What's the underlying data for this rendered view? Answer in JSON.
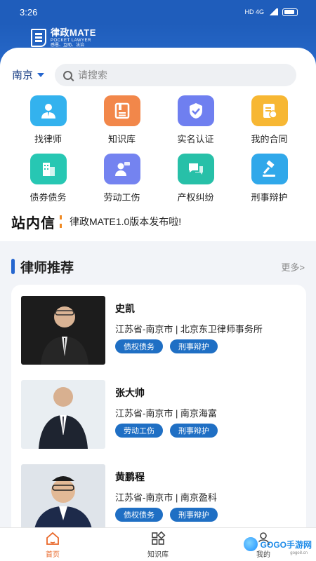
{
  "status": {
    "time": "3:26",
    "icons_right": "HD 4G"
  },
  "app": {
    "name": "律政MATE",
    "tagline": "POCKET LAWYER",
    "slogan": "感恩、互助、法治"
  },
  "search": {
    "city": "南京",
    "placeholder": "请搜索"
  },
  "features": [
    {
      "label": "找律师",
      "color": "#33b2ee",
      "icon": "lawyer-icon"
    },
    {
      "label": "知识库",
      "color": "#f2874a",
      "icon": "book-icon"
    },
    {
      "label": "实名认证",
      "color": "#6f7ff0",
      "icon": "verify-icon"
    },
    {
      "label": "我的合同",
      "color": "#f7b733",
      "icon": "contract-icon"
    },
    {
      "label": "债券债务",
      "color": "#27c7b3",
      "icon": "building-icon"
    },
    {
      "label": "劳动工伤",
      "color": "#7483f0",
      "icon": "worker-icon"
    },
    {
      "label": "产权纠纷",
      "color": "#27c0a8",
      "icon": "chat-icon"
    },
    {
      "label": "刑事辩护",
      "color": "#30a8ea",
      "icon": "gavel-icon"
    }
  ],
  "notice": {
    "title": "站内信",
    "text": "律政MATE1.0版本发布啦!"
  },
  "section": {
    "title": "律师推荐",
    "more": "更多>"
  },
  "lawyers": [
    {
      "name": "史凯",
      "location": "江苏省-南京市 | 北京东卫律师事务所",
      "tags": [
        "债权债务",
        "刑事辩护"
      ]
    },
    {
      "name": "张大帅",
      "location": "江苏省-南京市 | 南京海富",
      "tags": [
        "劳动工伤",
        "刑事辩护"
      ]
    },
    {
      "name": "黄鹏程",
      "location": "江苏省-南京市 | 南京盈科",
      "tags": [
        "债权债务",
        "刑事辩护"
      ]
    }
  ],
  "tabs": [
    {
      "label": "首页",
      "active": true
    },
    {
      "label": "知识库",
      "active": false
    },
    {
      "label": "我的",
      "active": false
    }
  ],
  "watermark": {
    "text": "GOGO手游网",
    "url": "gogo8.cn"
  }
}
